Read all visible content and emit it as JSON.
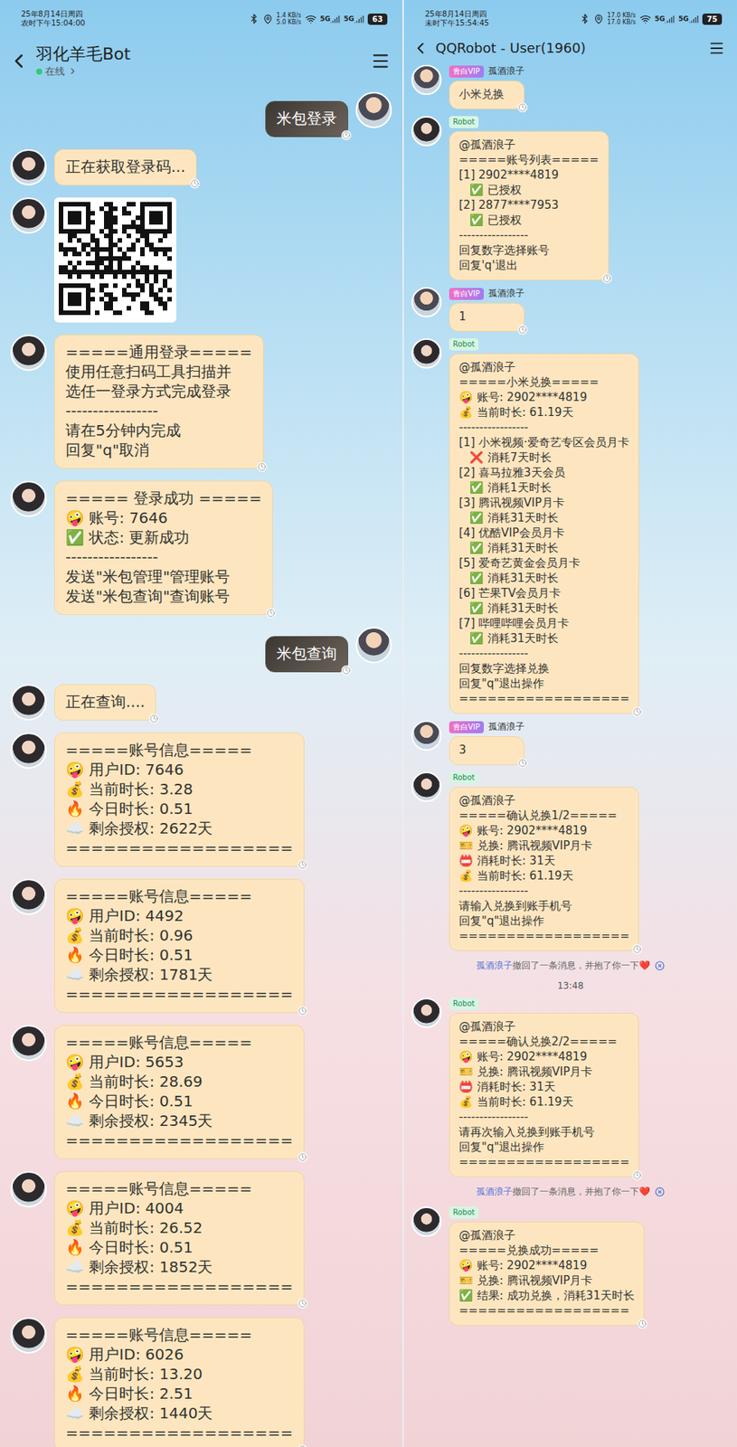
{
  "left_phone": {
    "status_bar": {
      "date": "25年8月14日周四",
      "time": "农时下午15:04:00",
      "speed": [
        "1.4 KB/s",
        "5.0 KB/s"
      ],
      "networks": [
        "5G",
        "5G"
      ],
      "battery": "63"
    },
    "header": {
      "back": "<",
      "title": "羽化羊毛Bot",
      "status": "在线",
      "online": true
    },
    "messages": [
      {
        "from": "me",
        "kind": "text",
        "lines": [
          "米包登录"
        ]
      },
      {
        "from": "bot",
        "kind": "text",
        "lines": [
          "正在获取登录码..."
        ]
      },
      {
        "from": "bot",
        "kind": "qr",
        "lines": []
      },
      {
        "from": "bot",
        "kind": "text",
        "lines": [
          "=====通用登录=====",
          "使用任意扫码工具扫描并",
          "选任一登录方式完成登录",
          "-----------------",
          "请在5分钟内完成",
          "回复\"q\"取消"
        ]
      },
      {
        "from": "bot",
        "kind": "text",
        "lines": [
          "===== 登录成功 =====",
          "🤪 账号: 7646",
          "✅ 状态: 更新成功",
          "-----------------",
          "发送\"米包管理\"管理账号",
          "发送\"米包查询\"查询账号"
        ]
      },
      {
        "from": "me",
        "kind": "text",
        "lines": [
          "米包查询"
        ]
      },
      {
        "from": "bot",
        "kind": "text",
        "lines": [
          "正在查询...."
        ]
      },
      {
        "from": "bot",
        "kind": "text",
        "lines": [
          "=====账号信息=====",
          "🤪 用户ID: 7646",
          "💰 当前时长: 3.28",
          "🔥 今日时长: 0.51",
          "☁️ 剩余授权: 2622天",
          "=================="
        ]
      },
      {
        "from": "bot",
        "kind": "text",
        "lines": [
          "=====账号信息=====",
          "🤪 用户ID: 4492",
          "💰 当前时长: 0.96",
          "🔥 今日时长: 0.51",
          "☁️ 剩余授权: 1781天",
          "=================="
        ]
      },
      {
        "from": "bot",
        "kind": "text",
        "lines": [
          "=====账号信息=====",
          "🤪 用户ID: 5653",
          "💰 当前时长: 28.69",
          "🔥 今日时长: 0.51",
          "☁️ 剩余授权: 2345天",
          "=================="
        ]
      },
      {
        "from": "bot",
        "kind": "text",
        "lines": [
          "=====账号信息=====",
          "🤪 用户ID: 4004",
          "💰 当前时长: 26.52",
          "🔥 今日时长: 0.51",
          "☁️ 剩余授权: 1852天",
          "=================="
        ]
      },
      {
        "from": "bot",
        "kind": "text",
        "lines": [
          "=====账号信息=====",
          "🤪 用户ID: 6026",
          "💰 当前时长: 13.20",
          "🔥 今日时长: 2.51",
          "☁️ 剩余授权: 1440天",
          "=================="
        ]
      }
    ]
  },
  "right_phone": {
    "status_bar": {
      "date": "25年8月14日周四",
      "time": "未时下午15:54:45",
      "speed": [
        "17.0 KB/s",
        "17.0 KB/s"
      ],
      "networks": [
        "5G",
        "5G"
      ],
      "battery": "75"
    },
    "header": {
      "back": "<",
      "title": "QQRobot - User(1960)"
    },
    "senders": {
      "user": {
        "name": "孤酒浪子",
        "badge": "青白VIP"
      },
      "bot": {
        "badge": "Robot"
      }
    },
    "messages": [
      {
        "kind": "text",
        "from": "user",
        "lines": [
          "小米兑换"
        ]
      },
      {
        "kind": "text",
        "from": "bot",
        "lines": [
          "@孤酒浪子",
          "=====账号列表=====",
          "[1] 2902****4819",
          "   ✅ 已授权",
          "[2] 2877****7953",
          "   ✅ 已授权",
          "-----------------",
          "回复数字选择账号",
          "回复'q'退出"
        ]
      },
      {
        "kind": "text",
        "from": "user",
        "lines": [
          "1"
        ]
      },
      {
        "kind": "text",
        "from": "bot",
        "lines": [
          "@孤酒浪子",
          "=====小米兑换=====",
          "🤪 账号: 2902****4819",
          "💰 当前时长: 61.19天",
          "-----------------",
          "[1] 小米视频·爱奇艺专区会员月卡",
          "   ❌ 消耗7天时长",
          "[2] 喜马拉雅3天会员",
          "   ✅ 消耗1天时长",
          "[3] 腾讯视频VIP月卡",
          "   ✅ 消耗31天时长",
          "[4] 优酷VIP会员月卡",
          "   ✅ 消耗31天时长",
          "[5] 爱奇艺黄金会员月卡",
          "   ✅ 消耗31天时长",
          "[6] 芒果TV会员月卡",
          "   ✅ 消耗31天时长",
          "[7] 哔哩哔哩会员月卡",
          "   ✅ 消耗31天时长",
          "-----------------",
          "回复数字选择兑换",
          "回复\"q\"退出操作",
          "=================="
        ]
      },
      {
        "kind": "text",
        "from": "user",
        "lines": [
          "3"
        ]
      },
      {
        "kind": "text",
        "from": "bot",
        "lines": [
          "@孤酒浪子",
          "=====确认兑换1/2=====",
          "🤪 账号: 2902****4819",
          "🎫 兑换: 腾讯视频VIP月卡",
          "📛 消耗时长: 31天",
          "💰 当前时长: 61.19天",
          "-----------------",
          "请输入兑换到账手机号",
          "回复\"q\"退出操作",
          "=================="
        ]
      },
      {
        "kind": "system",
        "name": "孤酒浪子",
        "text": "撤回了一条消息，并抱了你一下❤️"
      },
      {
        "kind": "time",
        "text": "13:48"
      },
      {
        "kind": "text",
        "from": "bot",
        "lines": [
          "@孤酒浪子",
          "=====确认兑换2/2=====",
          "🤪 账号: 2902****4819",
          "🎫 兑换: 腾讯视频VIP月卡",
          "📛 消耗时长: 31天",
          "💰 当前时长: 61.19天",
          "-----------------",
          "请再次输入兑换到账手机号",
          "回复\"q\"退出操作",
          "=================="
        ]
      },
      {
        "kind": "system",
        "name": "孤酒浪子",
        "text": "撤回了一条消息，并抱了你一下❤️"
      },
      {
        "kind": "text",
        "from": "bot",
        "lines": [
          "@孤酒浪子",
          "=====兑换成功=====",
          "🤪 账号: 2902****4819",
          "🎫 兑换: 腾讯视频VIP月卡",
          "✅ 结果: 成功兑换，消耗31天时长",
          "=================="
        ]
      }
    ]
  }
}
